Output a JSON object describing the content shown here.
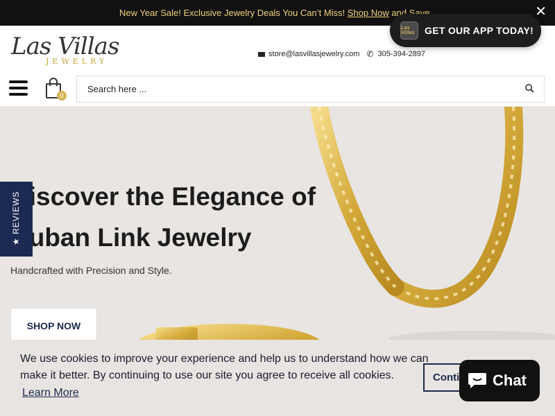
{
  "announcement": {
    "text": "New Year Sale! Exclusive Jewelry Deals You Can’t Miss! ",
    "link_text": "Shop Now",
    "suffix": " and Save",
    "close_symbol": "✕"
  },
  "header": {
    "logo_main": "Las Villas",
    "logo_sub": "JEWELRY",
    "email": "store@lasvillasjewelry.com",
    "phone": "305-394-2897",
    "cart_count": "0",
    "search_placeholder": "Search here ..."
  },
  "app_popup": {
    "label": "GET OUR APP TODAY!",
    "logo_text": "Las Villas"
  },
  "hero": {
    "headline_line1": "Discover the Elegance of",
    "headline_line2": "Cuban Link Jewelry",
    "subtitle": "Handcrafted with Precision and Style.",
    "button_label": "SHOP NOW"
  },
  "reviews_tab": {
    "label": "★ REVIEWS"
  },
  "cookie": {
    "message": "We use cookies to improve your experience and help us to understand how we can make it better. By continuing to use our site you agree to receive all cookies.",
    "learn_more": "Learn More",
    "continue_label": "Continue"
  },
  "chat": {
    "label": "Chat"
  },
  "colors": {
    "announce_bg": "#111111",
    "gold": "#d7b45a",
    "navy": "#1c2a4e",
    "hero_bg": "#e8e5e2"
  }
}
